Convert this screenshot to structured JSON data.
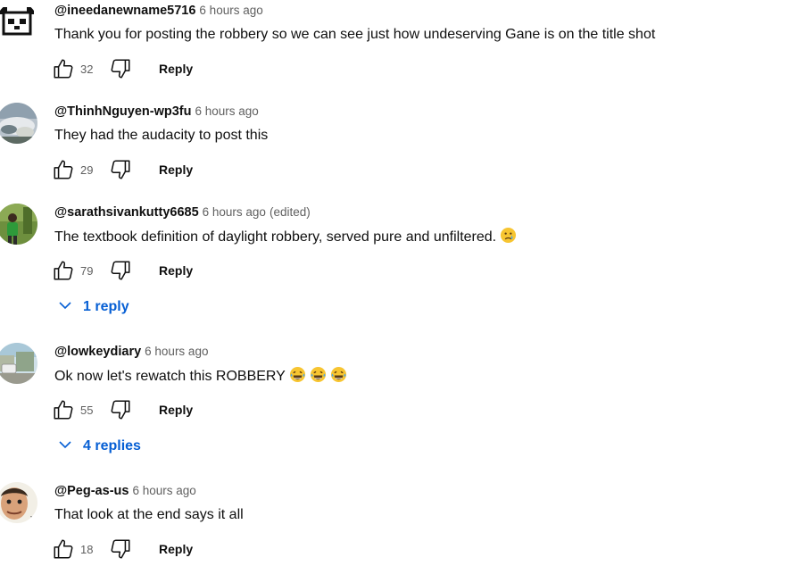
{
  "comments": [
    {
      "author": "@ineedanewname5716",
      "time": "6 hours ago",
      "edited": "",
      "text": "Thank you for posting the robbery so we can see just how undeserving Gane is on the title shot",
      "likes": "32",
      "reply_label": "Reply",
      "avatar_icon": "panda-avatar",
      "replies_label": ""
    },
    {
      "author": "@ThinhNguyen-wp3fu",
      "time": "6 hours ago",
      "edited": "",
      "text": "They had the audacity to post this",
      "likes": "29",
      "reply_label": "Reply",
      "avatar_icon": "landscape-avatar",
      "replies_label": ""
    },
    {
      "author": "@sarathsivankutty6685",
      "time": "6 hours ago",
      "edited": "(edited)",
      "text": "The textbook definition of daylight robbery, served pure and unfiltered.",
      "emojis": [
        "sad-tear-emoji"
      ],
      "likes": "79",
      "reply_label": "Reply",
      "avatar_icon": "person-outdoor-avatar",
      "replies_label": "1 reply"
    },
    {
      "author": "@lowkeydiary",
      "time": "6 hours ago",
      "edited": "",
      "text": "Ok now let's rewatch this ROBBERY",
      "emojis": [
        "laughing-tears-emoji",
        "laughing-tears-emoji",
        "laughing-tears-emoji"
      ],
      "likes": "55",
      "reply_label": "Reply",
      "avatar_icon": "street-scene-avatar",
      "replies_label": "4 replies"
    },
    {
      "author": "@Peg-as-us",
      "time": "6 hours ago",
      "edited": "",
      "text": "That look at the end says it all",
      "likes": "18",
      "reply_label": "Reply",
      "avatar_icon": "face-avatar",
      "replies_label": ""
    }
  ],
  "colors": {
    "link": "#065fd4",
    "meta": "#606060",
    "text": "#0f0f0f"
  }
}
